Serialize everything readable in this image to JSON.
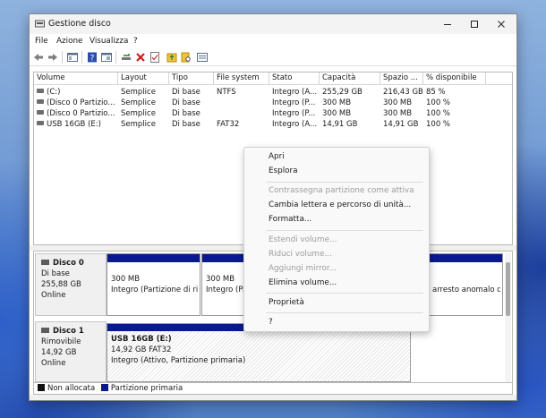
{
  "window": {
    "title": "Gestione disco",
    "minimize_icon": "minimize-icon",
    "maximize_icon": "maximize-icon",
    "close_icon": "close-icon"
  },
  "menubar": [
    "File",
    "Azione",
    "Visualizza",
    "?"
  ],
  "toolbar": {
    "icons": [
      "back-arrow-icon",
      "forward-arrow-icon",
      "console-tree-icon",
      "help-icon",
      "help-pane-icon",
      "connect-drive-icon",
      "delete-x-icon",
      "properties-check-icon",
      "folder-up-icon",
      "folder-search-icon",
      "view-list-icon"
    ]
  },
  "volume_table": {
    "headers": [
      "Volume",
      "Layout",
      "Tipo",
      "File system",
      "Stato",
      "Capacità",
      "Spazio ...",
      "% disponibile"
    ],
    "rows": [
      [
        "(C:)",
        "Semplice",
        "Di base",
        "NTFS",
        "Integro (A...",
        "255,29 GB",
        "216,43 GB",
        "85 %"
      ],
      [
        "(Disco 0 Partizio...",
        "Semplice",
        "Di base",
        "",
        "Integro (P...",
        "300 MB",
        "300 MB",
        "100 %"
      ],
      [
        "(Disco 0 Partizio...",
        "Semplice",
        "Di base",
        "",
        "Integro (P...",
        "300 MB",
        "300 MB",
        "100 %"
      ],
      [
        "USB 16GB (E:)",
        "Semplice",
        "Di base",
        "FAT32",
        "Integro (A...",
        "14,91 GB",
        "14,91 GB",
        "100 %"
      ]
    ]
  },
  "disks": [
    {
      "name": "Disco 0",
      "type": "Di base",
      "size": "255,88 GB",
      "status": "Online",
      "partitions": [
        {
          "size": "300 MB",
          "status": "Integro (Partizione di rip"
        },
        {
          "size": "300 MB",
          "status": "Integro (Par"
        },
        {
          "size": "",
          "status": "arresto anomalo de"
        }
      ]
    },
    {
      "name": "Disco 1",
      "type": "Rimovibile",
      "size": "14,92 GB",
      "status": "Online",
      "partitions": [
        {
          "name": "USB 16GB  (E:)",
          "size": "14,92 GB FAT32",
          "status": "Integro (Attivo, Partizione primaria)"
        }
      ]
    }
  ],
  "legend": {
    "unallocated": {
      "label": "Non allocata",
      "color": "#111111"
    },
    "primary": {
      "label": "Partizione primaria",
      "color": "#0a1a8a"
    }
  },
  "context_menu": {
    "items": [
      {
        "label": "Apri",
        "enabled": true
      },
      {
        "label": "Esplora",
        "enabled": true
      },
      {
        "label": "Contrassegna partizione come attiva",
        "enabled": false
      },
      {
        "label": "Cambia lettera e percorso di unità...",
        "enabled": true
      },
      {
        "label": "Formatta...",
        "enabled": true
      },
      {
        "label": "Estendi volume...",
        "enabled": false
      },
      {
        "label": "Riduci volume...",
        "enabled": false
      },
      {
        "label": "Aggiungi mirror...",
        "enabled": false
      },
      {
        "label": "Elimina volume...",
        "enabled": true
      },
      {
        "label": "Proprietà",
        "enabled": true
      },
      {
        "label": "?",
        "enabled": true
      }
    ]
  }
}
